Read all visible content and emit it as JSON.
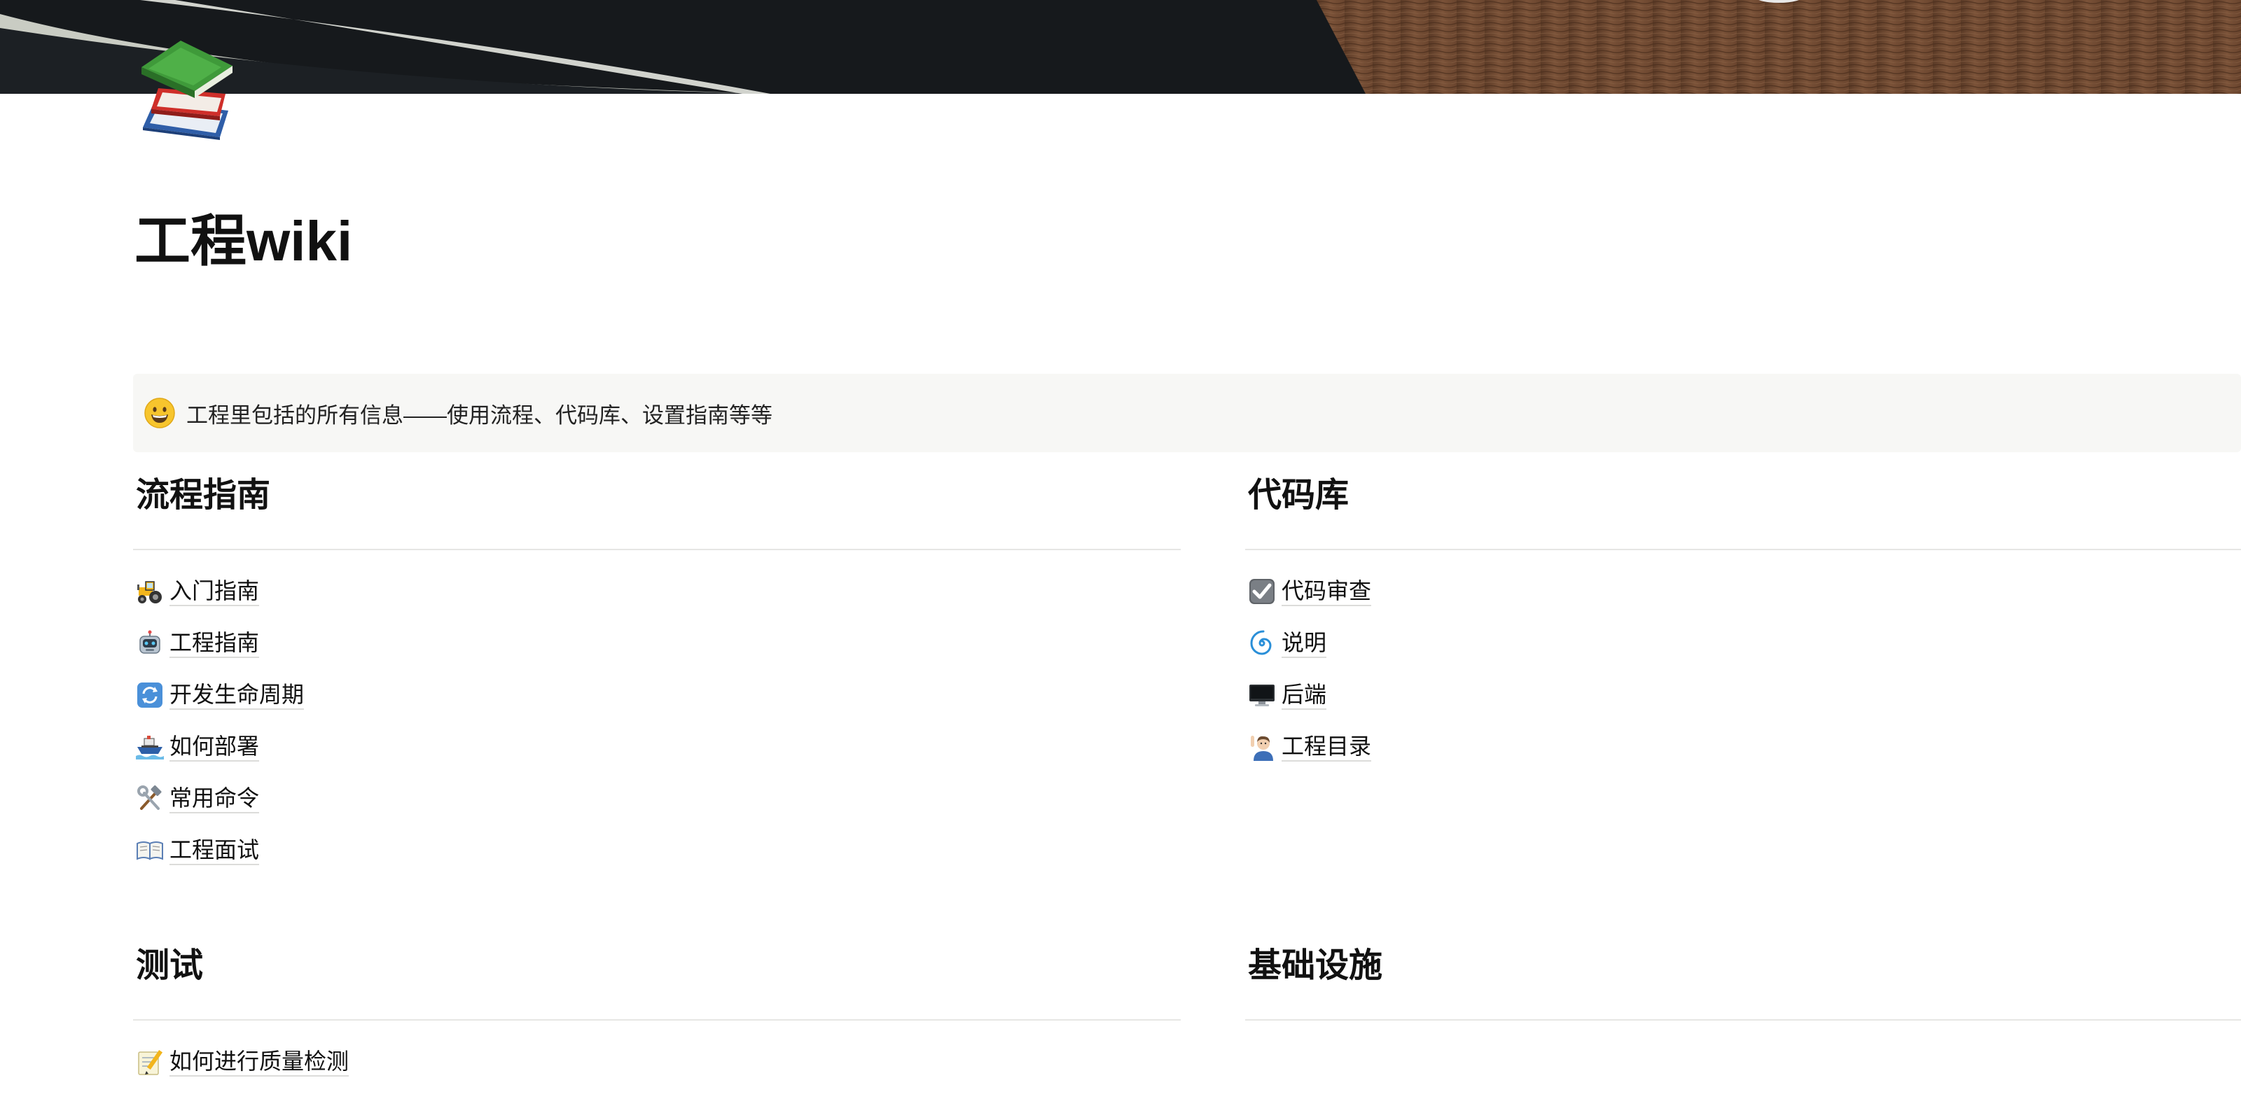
{
  "page": {
    "title": "工程wiki"
  },
  "callout": {
    "icon": "grinning-face-icon",
    "text": "工程里包括的所有信息——使用流程、代码库、设置指南等等"
  },
  "sections": [
    {
      "heading": "流程指南",
      "items": [
        {
          "icon": "tractor-icon",
          "label": "入门指南"
        },
        {
          "icon": "robot-icon",
          "label": "工程指南"
        },
        {
          "icon": "cycle-arrows-icon",
          "label": "开发生命周期"
        },
        {
          "icon": "ship-icon",
          "label": "如何部署"
        },
        {
          "icon": "hammer-wrench-icon",
          "label": "常用命令"
        },
        {
          "icon": "open-book-icon",
          "label": "工程面试"
        }
      ]
    },
    {
      "heading": "代码库",
      "items": [
        {
          "icon": "check-box-icon",
          "label": "代码审查"
        },
        {
          "icon": "cyclone-icon",
          "label": "说明"
        },
        {
          "icon": "desktop-computer-icon",
          "label": "后端"
        },
        {
          "icon": "person-raising-hand-icon",
          "label": "工程目录"
        }
      ]
    },
    {
      "heading": "测试",
      "items": [
        {
          "icon": "memo-icon",
          "label": "如何进行质量检测"
        }
      ]
    },
    {
      "heading": "基础设施",
      "items": []
    }
  ],
  "colors": {
    "text": "#111111",
    "callout_bg": "#f7f7f5",
    "divider": "#e6e6e4"
  }
}
